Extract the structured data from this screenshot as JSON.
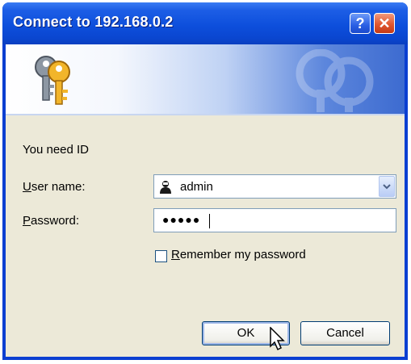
{
  "window": {
    "title": "Connect to 192.168.0.2",
    "help_icon": "help-icon",
    "close_icon": "close-icon"
  },
  "banner": {
    "icon": "keys-icon"
  },
  "form": {
    "prompt": "You need ID",
    "username_label_prefix": "U",
    "username_label_rest": "ser name:",
    "username_value": "admin",
    "password_label_prefix": "P",
    "password_label_rest": "assword:",
    "password_masked": "●●●●●",
    "remember_prefix": "R",
    "remember_rest": "emember my password",
    "remember_checked": false
  },
  "buttons": {
    "ok": "OK",
    "cancel": "Cancel"
  },
  "colors": {
    "titlebar": "#0a46d0",
    "client_bg": "#ece9d8",
    "close_button": "#e0562f"
  }
}
